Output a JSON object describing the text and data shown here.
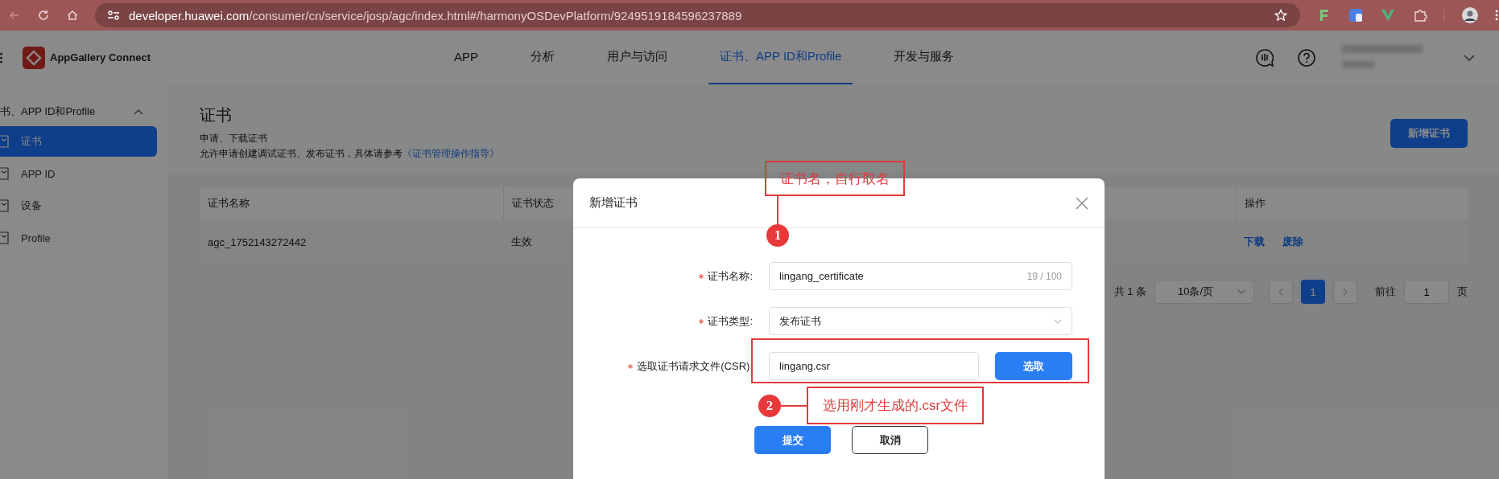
{
  "browser": {
    "url_host": "developer.huawei.com",
    "url_path": "/consumer/cn/service/josp/agc/index.html#/harmonyOSDevPlatform/9249519184596237889"
  },
  "app": {
    "brand": "AppGallery Connect",
    "nav": [
      {
        "label": "APP",
        "selected": false
      },
      {
        "label": "分析",
        "selected": false
      },
      {
        "label": "用户与访问",
        "selected": false
      },
      {
        "label": "证书、APP ID和Profile",
        "selected": true
      },
      {
        "label": "开发与服务",
        "selected": false
      }
    ]
  },
  "sidebar": {
    "group_title": "书、APP ID和Profile",
    "expanded": true,
    "items": [
      {
        "label": "证书",
        "selected": true
      },
      {
        "label": "APP ID",
        "selected": false
      },
      {
        "label": "设备",
        "selected": false
      },
      {
        "label": "Profile",
        "selected": false
      }
    ]
  },
  "page": {
    "title": "证书",
    "subtitle": "申请、下载证书",
    "description": "允许申请创建调试证书、发布证书，具体请参考",
    "link": "《证书管理操作指导》",
    "primary_button": "新增证书"
  },
  "table": {
    "columns": [
      "证书名称",
      "证书状态",
      "操作"
    ],
    "rows": [
      {
        "cells": [
          "agc_1752143272442",
          "生效"
        ],
        "actions": [
          "下载",
          "废除"
        ]
      }
    ]
  },
  "pagination": {
    "total": "共 1 条",
    "page_size": "10条/页",
    "pages": [
      {
        "label": "1",
        "selected": true
      }
    ],
    "goto_label": "前往",
    "goto_value": "1",
    "page_suffix": "页"
  },
  "dialog": {
    "title": "新增证书",
    "fields": [
      {
        "kind": "text",
        "label": "证书名称:",
        "required": true,
        "value": "lingang_certificate",
        "counter": "19 / 100"
      },
      {
        "kind": "select",
        "label": "证书类型:",
        "required": true,
        "value": "发布证书"
      },
      {
        "kind": "file",
        "label": "选取证书请求文件(CSR):",
        "required": true,
        "value": "lingang.csr",
        "button": "选取"
      }
    ],
    "buttons": [
      {
        "label": "提交",
        "kind": "primary"
      },
      {
        "label": "取消",
        "kind": "default"
      }
    ]
  },
  "annotations": [
    {
      "number": "1",
      "text": "证书名，自行取名"
    },
    {
      "number": "2",
      "text": "选用刚才生成的.csr文件"
    }
  ]
}
